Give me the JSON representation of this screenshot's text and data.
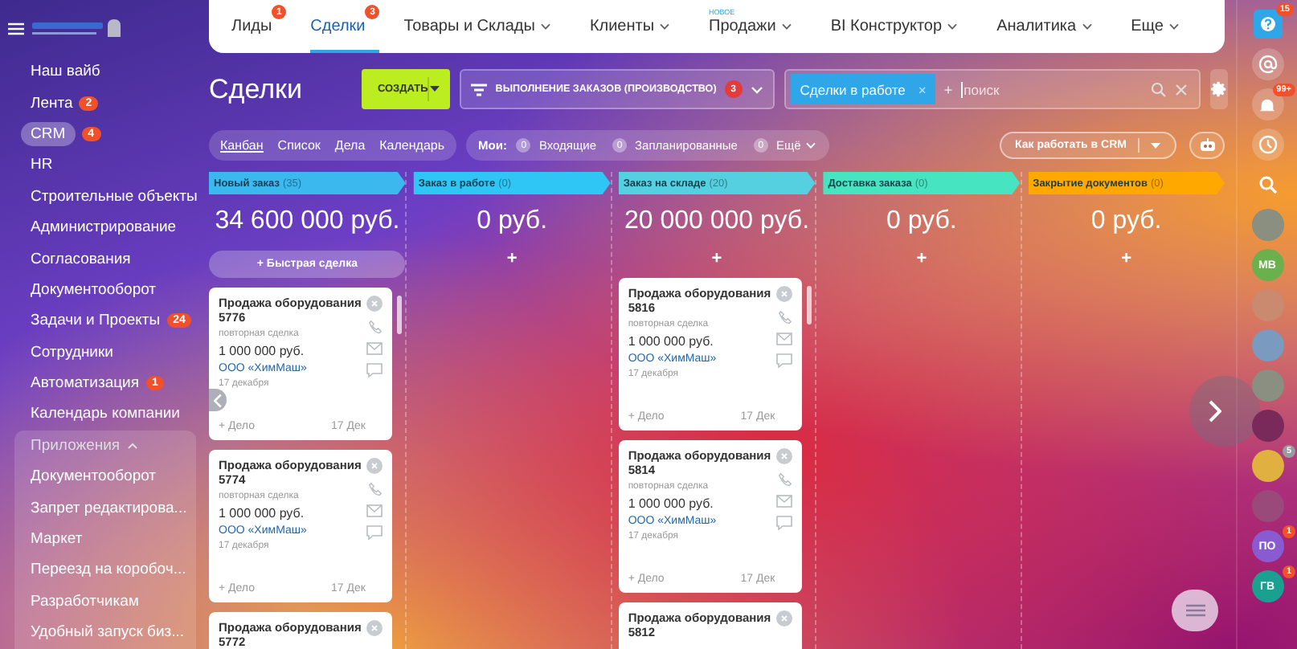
{
  "sidebar": {
    "items": [
      {
        "label": "Наш вайб",
        "selected": false
      },
      {
        "label": "Лента",
        "badge": "2",
        "selected": false
      },
      {
        "label": "CRM",
        "badge": "4",
        "selected": true
      },
      {
        "label": "HR",
        "selected": false
      },
      {
        "label": "Строительные объекты",
        "selected": false
      },
      {
        "label": "Администрирование",
        "selected": false
      },
      {
        "label": "Согласования",
        "selected": false
      },
      {
        "label": "Документооборот",
        "selected": false
      },
      {
        "label": "Задачи и Проекты",
        "badge": "24",
        "selected": false
      },
      {
        "label": "Сотрудники",
        "selected": false
      },
      {
        "label": "Автоматизация",
        "badge": "1",
        "selected": false
      },
      {
        "label": "Календарь компании",
        "selected": false
      }
    ],
    "apps": {
      "title": "Приложения",
      "expanded": true,
      "items": [
        "Документооборот",
        "Запрет редактирова...",
        "Маркет",
        "Переезд на коробоч...",
        "Разработчикам",
        "Удобный запуск биз..."
      ]
    }
  },
  "top_nav": {
    "tabs": [
      {
        "label": "Лиды",
        "badge": "1",
        "dropdown": false,
        "selected": false
      },
      {
        "label": "Сделки",
        "badge": "3",
        "dropdown": false,
        "selected": true
      },
      {
        "label": "Товары и Склады",
        "dropdown": true,
        "selected": false
      },
      {
        "label": "Клиенты",
        "dropdown": true,
        "selected": false
      },
      {
        "label": "Продажи",
        "note": "НОВОЕ",
        "dropdown": true,
        "selected": false
      },
      {
        "label": "BI Конструктор",
        "dropdown": true,
        "selected": false
      },
      {
        "label": "Аналитика",
        "dropdown": true,
        "selected": false
      },
      {
        "label": "Еще",
        "dropdown": true,
        "selected": false
      }
    ]
  },
  "toolbar": {
    "title": "Сделки",
    "create_button": "СОЗДАТЬ",
    "filter": {
      "label": "ВЫПОЛНЕНИЕ ЗАКАЗОВ (ПРОИЗВОДСТВО)",
      "badge": "3"
    },
    "search": {
      "tag": "Сделки в работе",
      "tag_close": "×",
      "plus": "+",
      "placeholder": "поиск"
    }
  },
  "views": {
    "tabs": [
      {
        "label": "Канбан",
        "selected": true
      },
      {
        "label": "Список",
        "selected": false
      },
      {
        "label": "Дела",
        "selected": false
      },
      {
        "label": "Календарь",
        "selected": false
      }
    ],
    "counters_label": "Мои:",
    "counters": [
      {
        "count": "0",
        "label": "Входящие",
        "dropdown": false
      },
      {
        "count": "0",
        "label": "Запланированные",
        "dropdown": false
      },
      {
        "count": "0",
        "label": "Ещё",
        "dropdown": true
      }
    ],
    "help_button": "Как работать в CRM"
  },
  "columns": [
    {
      "title": "Новый заказ",
      "count": "(35)",
      "color": "#3bb8ee",
      "sum": "34 600 000 руб.",
      "quick_add": "Быстрая сделка",
      "add": "+",
      "cards": [
        {
          "title": "Продажа оборудования",
          "number": "5776",
          "type": "повторная сделка",
          "price": "1 000 000 руб.",
          "company": "ООО «ХимМаш»",
          "date": "17 декабря",
          "activity": "+ Дело",
          "short_date": "17 Дек"
        },
        {
          "title": "Продажа оборудования",
          "number": "5774",
          "type": "повторная сделка",
          "price": "1 000 000 руб.",
          "company": "ООО «ХимМаш»",
          "date": "17 декабря",
          "activity": "+ Дело",
          "short_date": "17 Дек"
        },
        {
          "title": "Продажа оборудования",
          "number": "5772"
        }
      ]
    },
    {
      "title": "Заказ в работе",
      "count": "(0)",
      "color": "#2fc6f6",
      "sum": "0 руб.",
      "add": "+"
    },
    {
      "title": "Заказ на складе",
      "count": "(20)",
      "color": "#55d0e0",
      "sum": "20 000 000 руб.",
      "add": "+",
      "cards": [
        {
          "title": "Продажа оборудования",
          "number": "5816",
          "type": "повторная сделка",
          "price": "1 000 000 руб.",
          "company": "ООО «ХимМаш»",
          "date": "17 декабря",
          "activity": "+ Дело",
          "short_date": "17 Дек"
        },
        {
          "title": "Продажа оборудования",
          "number": "5814",
          "type": "повторная сделка",
          "price": "1 000 000 руб.",
          "company": "ООО «ХимМаш»",
          "date": "17 декабря",
          "activity": "+ Дело",
          "short_date": "17 Дек"
        },
        {
          "title": "Продажа оборудования",
          "number": "5812"
        }
      ]
    },
    {
      "title": "Доставка заказа",
      "count": "(0)",
      "color": "#47e4c2",
      "sum": "0 руб.",
      "add": "+"
    },
    {
      "title": "Закрытие документов",
      "count": "(0)",
      "color": "#ffa900",
      "sum": "0 руб.",
      "add": "+"
    }
  ],
  "right_bar": [
    {
      "kind": "help",
      "badge": "15"
    },
    {
      "kind": "at"
    },
    {
      "kind": "bell",
      "badge": "99+"
    },
    {
      "kind": "clock"
    },
    {
      "kind": "search"
    },
    {
      "kind": "avatar",
      "color": "#8a8f80"
    },
    {
      "kind": "initials",
      "initials": "МВ",
      "color": "#6ab04c"
    },
    {
      "kind": "avatar",
      "color": "#c98a70"
    },
    {
      "kind": "avatar",
      "color": "#7a9ac0"
    },
    {
      "kind": "avatar",
      "color": "#8a8f81"
    },
    {
      "kind": "avatar",
      "color": "#7a2a5a"
    },
    {
      "kind": "avatar",
      "color": "#e0b040",
      "badge": "5"
    },
    {
      "kind": "avatar",
      "color": "#9a4a7a"
    },
    {
      "kind": "initials",
      "initials": "ПО",
      "color": "#8a5ad0",
      "badge": "1"
    },
    {
      "kind": "initials",
      "initials": "ГВ",
      "color": "#1aa090",
      "badge": "1"
    }
  ]
}
